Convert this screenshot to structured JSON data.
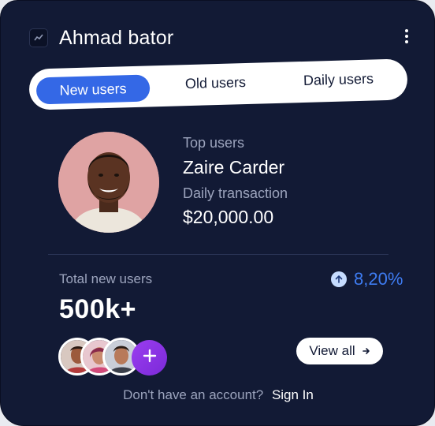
{
  "header": {
    "title": "Ahmad bator",
    "icon": "trend-icon",
    "menu_icon": "kebab-menu-icon"
  },
  "tabs": [
    {
      "label": "New users",
      "active": true
    },
    {
      "label": "Old users",
      "active": false
    },
    {
      "label": "Daily users",
      "active": false
    }
  ],
  "top_user": {
    "label": "Top users",
    "name": "Zaire Carder",
    "transaction_label": "Daily transaction",
    "transaction_value": "$20,000.00"
  },
  "stats": {
    "total_label": "Total new users",
    "total_value": "500k+",
    "growth_value": "8,20%",
    "growth_icon": "arrow-up-icon"
  },
  "actions": {
    "view_all_label": "View all",
    "view_all_icon": "arrow-right-icon",
    "add_icon": "plus-icon"
  },
  "footer": {
    "question": "Don't have an account?",
    "link": "Sign In"
  },
  "colors": {
    "card_bg": "#121a35",
    "accent_blue": "#3468e6",
    "growth_blue": "#3e7cf2",
    "add_purple": "#8a33e4",
    "muted_text": "#9ca4bd"
  }
}
